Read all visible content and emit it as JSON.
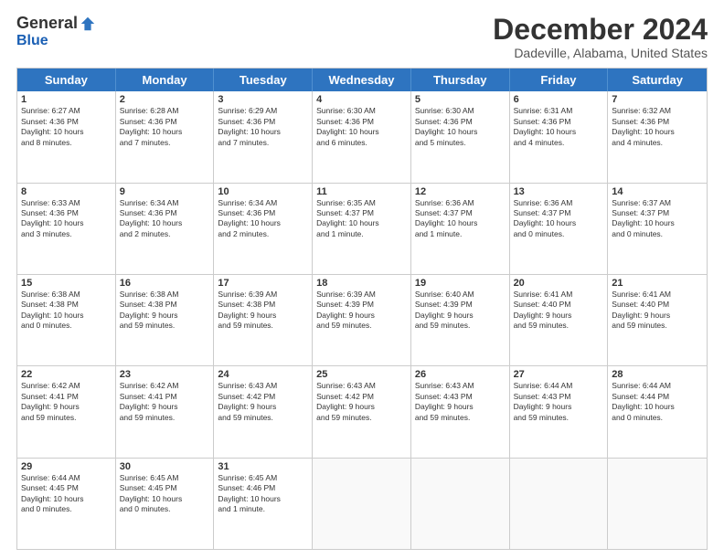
{
  "logo": {
    "general": "General",
    "blue": "Blue"
  },
  "title": "December 2024",
  "subtitle": "Dadeville, Alabama, United States",
  "header_days": [
    "Sunday",
    "Monday",
    "Tuesday",
    "Wednesday",
    "Thursday",
    "Friday",
    "Saturday"
  ],
  "weeks": [
    [
      {
        "day": "1",
        "lines": [
          "Sunrise: 6:27 AM",
          "Sunset: 4:36 PM",
          "Daylight: 10 hours",
          "and 8 minutes."
        ]
      },
      {
        "day": "2",
        "lines": [
          "Sunrise: 6:28 AM",
          "Sunset: 4:36 PM",
          "Daylight: 10 hours",
          "and 7 minutes."
        ]
      },
      {
        "day": "3",
        "lines": [
          "Sunrise: 6:29 AM",
          "Sunset: 4:36 PM",
          "Daylight: 10 hours",
          "and 7 minutes."
        ]
      },
      {
        "day": "4",
        "lines": [
          "Sunrise: 6:30 AM",
          "Sunset: 4:36 PM",
          "Daylight: 10 hours",
          "and 6 minutes."
        ]
      },
      {
        "day": "5",
        "lines": [
          "Sunrise: 6:30 AM",
          "Sunset: 4:36 PM",
          "Daylight: 10 hours",
          "and 5 minutes."
        ]
      },
      {
        "day": "6",
        "lines": [
          "Sunrise: 6:31 AM",
          "Sunset: 4:36 PM",
          "Daylight: 10 hours",
          "and 4 minutes."
        ]
      },
      {
        "day": "7",
        "lines": [
          "Sunrise: 6:32 AM",
          "Sunset: 4:36 PM",
          "Daylight: 10 hours",
          "and 4 minutes."
        ]
      }
    ],
    [
      {
        "day": "8",
        "lines": [
          "Sunrise: 6:33 AM",
          "Sunset: 4:36 PM",
          "Daylight: 10 hours",
          "and 3 minutes."
        ]
      },
      {
        "day": "9",
        "lines": [
          "Sunrise: 6:34 AM",
          "Sunset: 4:36 PM",
          "Daylight: 10 hours",
          "and 2 minutes."
        ]
      },
      {
        "day": "10",
        "lines": [
          "Sunrise: 6:34 AM",
          "Sunset: 4:36 PM",
          "Daylight: 10 hours",
          "and 2 minutes."
        ]
      },
      {
        "day": "11",
        "lines": [
          "Sunrise: 6:35 AM",
          "Sunset: 4:37 PM",
          "Daylight: 10 hours",
          "and 1 minute."
        ]
      },
      {
        "day": "12",
        "lines": [
          "Sunrise: 6:36 AM",
          "Sunset: 4:37 PM",
          "Daylight: 10 hours",
          "and 1 minute."
        ]
      },
      {
        "day": "13",
        "lines": [
          "Sunrise: 6:36 AM",
          "Sunset: 4:37 PM",
          "Daylight: 10 hours",
          "and 0 minutes."
        ]
      },
      {
        "day": "14",
        "lines": [
          "Sunrise: 6:37 AM",
          "Sunset: 4:37 PM",
          "Daylight: 10 hours",
          "and 0 minutes."
        ]
      }
    ],
    [
      {
        "day": "15",
        "lines": [
          "Sunrise: 6:38 AM",
          "Sunset: 4:38 PM",
          "Daylight: 10 hours",
          "and 0 minutes."
        ]
      },
      {
        "day": "16",
        "lines": [
          "Sunrise: 6:38 AM",
          "Sunset: 4:38 PM",
          "Daylight: 9 hours",
          "and 59 minutes."
        ]
      },
      {
        "day": "17",
        "lines": [
          "Sunrise: 6:39 AM",
          "Sunset: 4:38 PM",
          "Daylight: 9 hours",
          "and 59 minutes."
        ]
      },
      {
        "day": "18",
        "lines": [
          "Sunrise: 6:39 AM",
          "Sunset: 4:39 PM",
          "Daylight: 9 hours",
          "and 59 minutes."
        ]
      },
      {
        "day": "19",
        "lines": [
          "Sunrise: 6:40 AM",
          "Sunset: 4:39 PM",
          "Daylight: 9 hours",
          "and 59 minutes."
        ]
      },
      {
        "day": "20",
        "lines": [
          "Sunrise: 6:41 AM",
          "Sunset: 4:40 PM",
          "Daylight: 9 hours",
          "and 59 minutes."
        ]
      },
      {
        "day": "21",
        "lines": [
          "Sunrise: 6:41 AM",
          "Sunset: 4:40 PM",
          "Daylight: 9 hours",
          "and 59 minutes."
        ]
      }
    ],
    [
      {
        "day": "22",
        "lines": [
          "Sunrise: 6:42 AM",
          "Sunset: 4:41 PM",
          "Daylight: 9 hours",
          "and 59 minutes."
        ]
      },
      {
        "day": "23",
        "lines": [
          "Sunrise: 6:42 AM",
          "Sunset: 4:41 PM",
          "Daylight: 9 hours",
          "and 59 minutes."
        ]
      },
      {
        "day": "24",
        "lines": [
          "Sunrise: 6:43 AM",
          "Sunset: 4:42 PM",
          "Daylight: 9 hours",
          "and 59 minutes."
        ]
      },
      {
        "day": "25",
        "lines": [
          "Sunrise: 6:43 AM",
          "Sunset: 4:42 PM",
          "Daylight: 9 hours",
          "and 59 minutes."
        ]
      },
      {
        "day": "26",
        "lines": [
          "Sunrise: 6:43 AM",
          "Sunset: 4:43 PM",
          "Daylight: 9 hours",
          "and 59 minutes."
        ]
      },
      {
        "day": "27",
        "lines": [
          "Sunrise: 6:44 AM",
          "Sunset: 4:43 PM",
          "Daylight: 9 hours",
          "and 59 minutes."
        ]
      },
      {
        "day": "28",
        "lines": [
          "Sunrise: 6:44 AM",
          "Sunset: 4:44 PM",
          "Daylight: 10 hours",
          "and 0 minutes."
        ]
      }
    ],
    [
      {
        "day": "29",
        "lines": [
          "Sunrise: 6:44 AM",
          "Sunset: 4:45 PM",
          "Daylight: 10 hours",
          "and 0 minutes."
        ]
      },
      {
        "day": "30",
        "lines": [
          "Sunrise: 6:45 AM",
          "Sunset: 4:45 PM",
          "Daylight: 10 hours",
          "and 0 minutes."
        ]
      },
      {
        "day": "31",
        "lines": [
          "Sunrise: 6:45 AM",
          "Sunset: 4:46 PM",
          "Daylight: 10 hours",
          "and 1 minute."
        ]
      },
      {
        "day": "",
        "lines": []
      },
      {
        "day": "",
        "lines": []
      },
      {
        "day": "",
        "lines": []
      },
      {
        "day": "",
        "lines": []
      }
    ]
  ]
}
